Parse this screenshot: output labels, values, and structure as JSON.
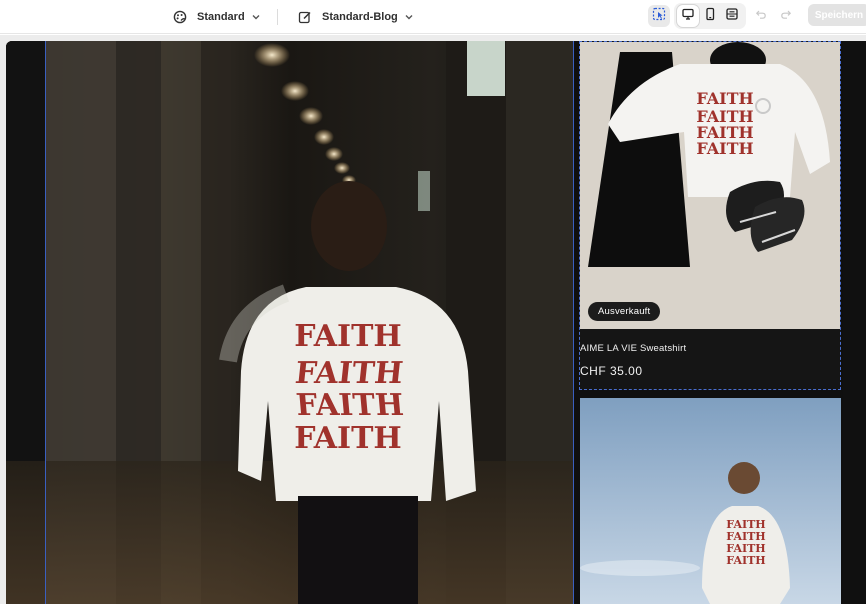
{
  "toolbar": {
    "theme": {
      "label": "Standard",
      "icon": "palette-icon"
    },
    "template": {
      "label": "Standard-Blog",
      "icon": "edit-icon"
    },
    "icons": {
      "inspector": "inspector-select-icon",
      "desktop": "desktop-icon",
      "mobile": "mobile-icon",
      "fullwidth": "fullwidth-icon",
      "undo": "undo-icon",
      "redo": "redo-icon"
    },
    "save_label": "Speichern"
  },
  "preview": {
    "hero": {
      "print_text": [
        "FAITH",
        "FAITH",
        "FAITH",
        "FAITH"
      ]
    },
    "products": [
      {
        "badge": "Ausverkauft",
        "title": "AIME LA VIE Sweatshirt",
        "price": "CHF 35.00",
        "print_text": [
          "FAITH",
          "FAITH",
          "FAITH",
          "FAITH"
        ]
      },
      {
        "print_text": [
          "FAITH",
          "FAITH",
          "FAITH",
          "FAITH"
        ]
      }
    ]
  },
  "colors": {
    "accent_selection": "#3a5fc0",
    "print_red": "#a0322c",
    "preview_bg": "#0f0f0f"
  }
}
